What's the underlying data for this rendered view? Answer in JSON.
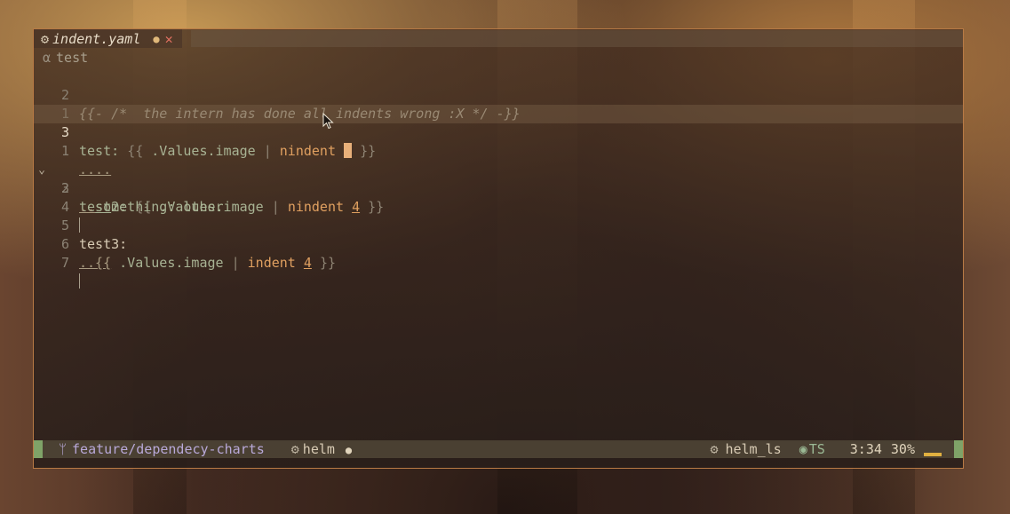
{
  "tab": {
    "filename": "indent.yaml",
    "modified_dot": "●",
    "close": "✕"
  },
  "breadcrumb": {
    "symbol": "α",
    "text": "test"
  },
  "lines": [
    {
      "num": "2",
      "text": "{{- /*  the intern has done all indents wrong :X */ -}}"
    },
    {
      "num": "1",
      "text": ""
    },
    {
      "num": "3",
      "key": "test:",
      "open": "{{",
      "var": ".Values.image",
      "pipe": "|",
      "fn": "nindent",
      "close": "}}"
    },
    {
      "num": "1",
      "ws": "...."
    },
    {
      "num": "2",
      "fold": "⌄",
      "key": "test2:",
      "open": "{{",
      "var": ".Values.image",
      "pipe": "|",
      "fn": "nindent",
      "arg": "4",
      "close": "}}"
    },
    {
      "num": "3",
      "ws": "..",
      "ul": "so",
      "key": "mething:",
      "val": "other"
    },
    {
      "num": "4"
    },
    {
      "num": "5",
      "key": "test3:"
    },
    {
      "num": "6",
      "ws": "..{{",
      "var": ".Values.image",
      "pipe": "|",
      "fn": "indent",
      "arg": "4",
      "close": "}}"
    },
    {
      "num": "7"
    }
  ],
  "statusbar": {
    "branch": "feature/dependecy-charts",
    "filetype": "helm",
    "modified_dot": "●",
    "lsp": "helm_ls",
    "treesitter": "TS",
    "position": "3:34",
    "percent": "30%"
  },
  "colors": {
    "accent_green": "#7fa368",
    "cursor": "#e8b07a",
    "border": "#b87a45"
  }
}
